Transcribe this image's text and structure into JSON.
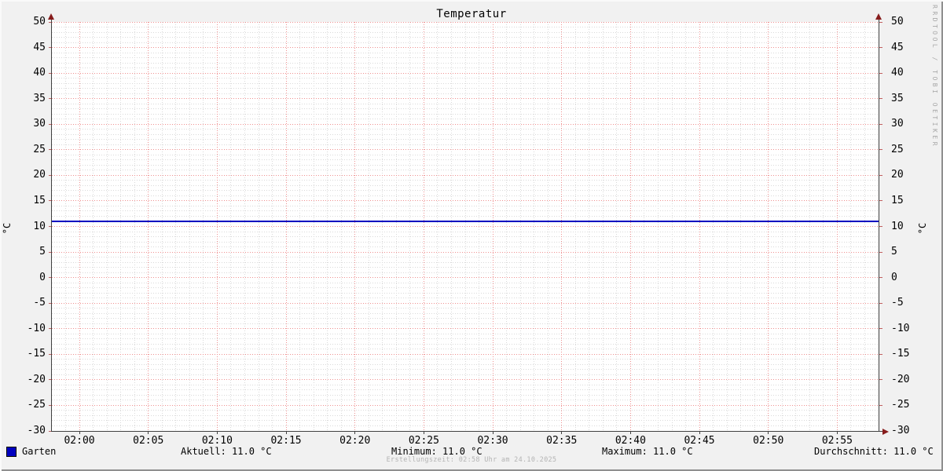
{
  "title": "Temperatur",
  "y_unit": "°C",
  "watermark": "RRDTOOL / TOBI OETIKER",
  "footer": "Erstellungszeit: 02:58 Uhr am 24.10.2025",
  "legend": {
    "series": "Garten",
    "aktuell": "Aktuell: 11.0 °C",
    "minimum": "Minimum: 11.0 °C",
    "maximum": "Maximum: 11.0 °C",
    "durchschnitt": "Durchschnitt: 11.0 °C"
  },
  "colors": {
    "series": "#0000c0",
    "grid_major": "#ef9090",
    "grid_minor": "#d9d9d9",
    "axis": "#404040",
    "arrow": "#871c1c",
    "background": "#f1f1f1",
    "canvas": "#ffffff",
    "tick_label": "#000000",
    "side_tick": "#c06060"
  },
  "chart_data": {
    "type": "line",
    "title": "Temperatur",
    "ylabel": "°C",
    "ylim": [
      -30,
      50
    ],
    "y_major_step": 5,
    "y_minor_step": 1,
    "x_start": "01:58",
    "x_end": "02:58",
    "x_total_minutes": 60,
    "x_minor_step_minutes": 1,
    "x_ticks": [
      {
        "label": "02:00",
        "minute": 2
      },
      {
        "label": "02:05",
        "minute": 7
      },
      {
        "label": "02:10",
        "minute": 12
      },
      {
        "label": "02:15",
        "minute": 17
      },
      {
        "label": "02:20",
        "minute": 22
      },
      {
        "label": "02:25",
        "minute": 27
      },
      {
        "label": "02:30",
        "minute": 32
      },
      {
        "label": "02:35",
        "minute": 37
      },
      {
        "label": "02:40",
        "minute": 42
      },
      {
        "label": "02:45",
        "minute": 47
      },
      {
        "label": "02:50",
        "minute": 52
      },
      {
        "label": "02:55",
        "minute": 57
      }
    ],
    "series": [
      {
        "name": "Garten",
        "color": "#0000c0",
        "constant_value": 11.0
      }
    ],
    "stats": {
      "aktuell": 11.0,
      "minimum": 11.0,
      "maximum": 11.0,
      "durchschnitt": 11.0,
      "unit": "°C"
    },
    "grid": true,
    "legend_position": "bottom"
  }
}
